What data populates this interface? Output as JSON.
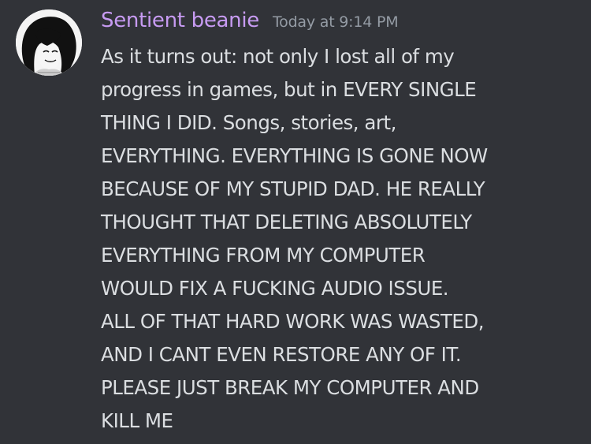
{
  "message": {
    "author": "Sentient beanie",
    "timestamp": "Today at 9:14 PM",
    "avatar_icon": "user-avatar-drawing",
    "lines": [
      "As it turns out: not only I lost all of my",
      "progress in games, but in EVERY SINGLE",
      "THING I DID. Songs, stories, art,",
      "EVERYTHING. EVERYTHING IS GONE NOW",
      "BECAUSE OF MY STUPID DAD. HE REALLY",
      "THOUGHT THAT DELETING ABSOLUTELY",
      "EVERYTHING FROM MY COMPUTER",
      "WOULD FIX A FUCKING AUDIO ISSUE.",
      "ALL OF THAT HARD WORK WAS WASTED,",
      "AND I CANT EVEN RESTORE ANY OF IT.",
      "PLEASE JUST BREAK MY COMPUTER AND",
      "KILL ME"
    ]
  },
  "colors": {
    "background": "#313338",
    "username": "#c79bf2",
    "timestamp": "#949ba4",
    "text": "#dbdee1"
  }
}
